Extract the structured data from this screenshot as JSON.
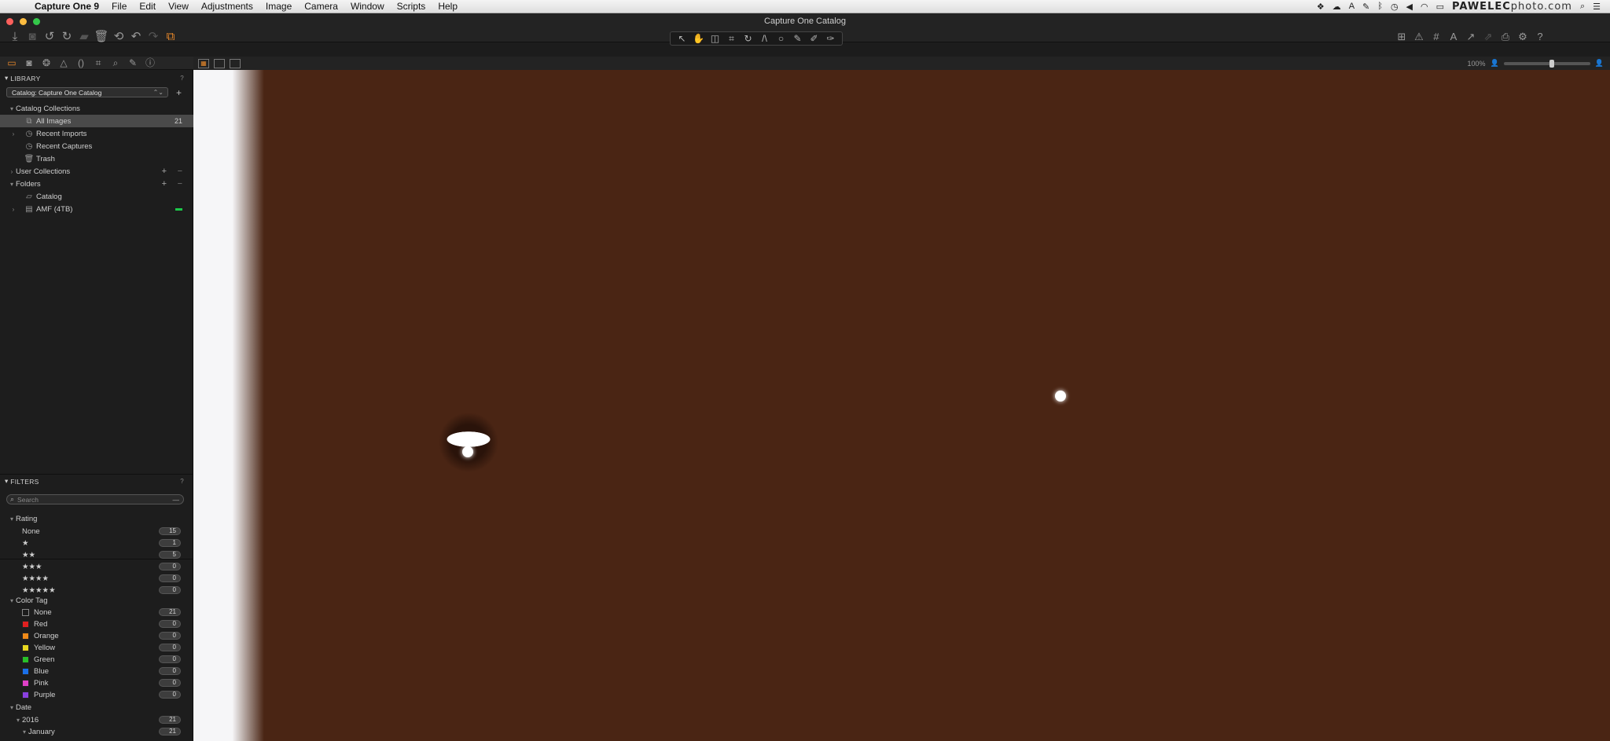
{
  "menubar": {
    "app_name": "Capture One 9",
    "items": [
      "File",
      "Edit",
      "View",
      "Adjustments",
      "Image",
      "Camera",
      "Window",
      "Scripts",
      "Help"
    ],
    "logo_text_a": "PAWELEC",
    "logo_text_b": "photo.com"
  },
  "window": {
    "title": "Capture One Catalog",
    "traffic_colors": [
      "#fc605c",
      "#fdbc40",
      "#34c84a"
    ],
    "accent": "#e8882a"
  },
  "viewer": {
    "zoom_label": "100%"
  },
  "library": {
    "header": "LIBRARY",
    "help": "?",
    "catalog_select": "Catalog: Capture One Catalog",
    "catalog_collections": "Catalog Collections",
    "items": [
      {
        "label": "All Images",
        "count": "21",
        "icon": "images-icon"
      },
      {
        "label": "Recent Imports",
        "count": "",
        "icon": "clock-icon"
      },
      {
        "label": "Recent Captures",
        "count": "",
        "icon": "clock-icon"
      },
      {
        "label": "Trash",
        "count": "",
        "icon": "trash-icon"
      }
    ],
    "user_collections": "User Collections",
    "folders": "Folders",
    "folder_items": [
      {
        "label": "Catalog",
        "icon": "folder-icon"
      },
      {
        "label": "AMF (4TB)",
        "icon": "drive-icon"
      }
    ]
  },
  "filters": {
    "header": "FILTERS",
    "help": "?",
    "search_placeholder": "Search",
    "rating_label": "Rating",
    "ratings": [
      {
        "label": "None",
        "count": "15"
      },
      {
        "label": "★",
        "count": "1"
      },
      {
        "label": "★★",
        "count": "5"
      },
      {
        "label": "★★★",
        "count": "0"
      },
      {
        "label": "★★★★",
        "count": "0"
      },
      {
        "label": "★★★★★",
        "count": "0"
      }
    ],
    "color_tag_label": "Color Tag",
    "color_tags": [
      {
        "label": "None",
        "count": "21",
        "color": "#1d1d1d"
      },
      {
        "label": "Red",
        "count": "0",
        "color": "#e02020"
      },
      {
        "label": "Orange",
        "count": "0",
        "color": "#f08a18"
      },
      {
        "label": "Yellow",
        "count": "0",
        "color": "#e8d820"
      },
      {
        "label": "Green",
        "count": "0",
        "color": "#28c028"
      },
      {
        "label": "Blue",
        "count": "0",
        "color": "#1a70e8"
      },
      {
        "label": "Pink",
        "count": "0",
        "color": "#e040c8"
      },
      {
        "label": "Purple",
        "count": "0",
        "color": "#8a40e0"
      }
    ],
    "date_label": "Date",
    "date_items": [
      {
        "label": "2016",
        "count": "21"
      },
      {
        "label": "January",
        "count": "21"
      }
    ]
  }
}
